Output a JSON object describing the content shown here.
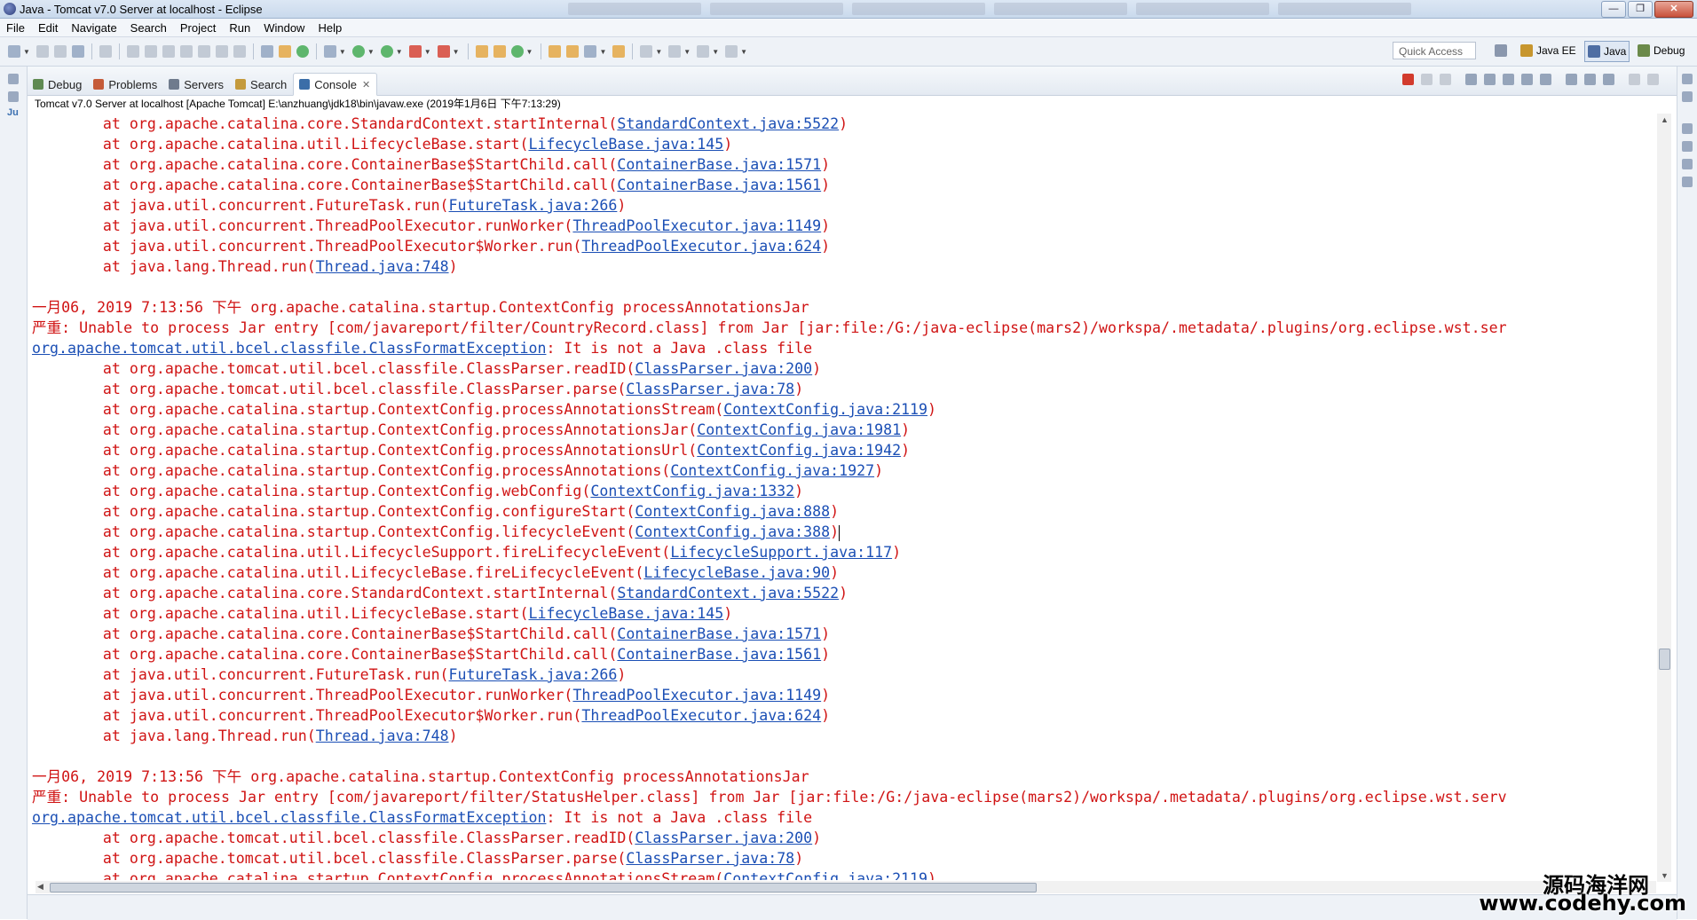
{
  "window": {
    "title": "Java - Tomcat v7.0 Server at localhost - Eclipse",
    "controls": {
      "minimize": "—",
      "maximize": "❐",
      "close": "✕"
    }
  },
  "menu": [
    "File",
    "Edit",
    "Navigate",
    "Search",
    "Project",
    "Run",
    "Window",
    "Help"
  ],
  "toolbar": {
    "quick_access": "Quick Access",
    "perspectives": [
      "Java EE",
      "Java",
      "Debug"
    ]
  },
  "views": {
    "tabs": [
      "Debug",
      "Problems",
      "Servers",
      "Search",
      "Console"
    ],
    "active": "Console",
    "close_glyph": "✕"
  },
  "console": {
    "description": "Tomcat v7.0 Server at localhost [Apache Tomcat] E:\\anzhuang\\jdk18\\bin\\javaw.exe (2019年1月6日 下午7:13:29)",
    "lines": [
      {
        "pre": "        at org.apache.catalina.core.StandardContext.startInternal(",
        "link": "StandardContext.java:5522",
        "post": ")"
      },
      {
        "pre": "        at org.apache.catalina.util.LifecycleBase.start(",
        "link": "LifecycleBase.java:145",
        "post": ")"
      },
      {
        "pre": "        at org.apache.catalina.core.ContainerBase$StartChild.call(",
        "link": "ContainerBase.java:1571",
        "post": ")"
      },
      {
        "pre": "        at org.apache.catalina.core.ContainerBase$StartChild.call(",
        "link": "ContainerBase.java:1561",
        "post": ")"
      },
      {
        "pre": "        at java.util.concurrent.FutureTask.run(",
        "link": "FutureTask.java:266",
        "post": ")"
      },
      {
        "pre": "        at java.util.concurrent.ThreadPoolExecutor.runWorker(",
        "link": "ThreadPoolExecutor.java:1149",
        "post": ")"
      },
      {
        "pre": "        at java.util.concurrent.ThreadPoolExecutor$Worker.run(",
        "link": "ThreadPoolExecutor.java:624",
        "post": ")"
      },
      {
        "pre": "        at java.lang.Thread.run(",
        "link": "Thread.java:748",
        "post": ")"
      },
      {
        "pre": ""
      },
      {
        "pre": "一月06, 2019 7:13:56 下午 org.apache.catalina.startup.ContextConfig processAnnotationsJar"
      },
      {
        "pre": "严重: Unable to process Jar entry [com/javareport/filter/CountryRecord.class] from Jar [jar:file:/G:/java-eclipse(mars2)/workspa/.metadata/.plugins/org.eclipse.wst.ser"
      },
      {
        "pre": "",
        "link": "org.apache.tomcat.util.bcel.classfile.ClassFormatException",
        "post": ": It is not a Java .class file"
      },
      {
        "pre": "        at org.apache.tomcat.util.bcel.classfile.ClassParser.readID(",
        "link": "ClassParser.java:200",
        "post": ")"
      },
      {
        "pre": "        at org.apache.tomcat.util.bcel.classfile.ClassParser.parse(",
        "link": "ClassParser.java:78",
        "post": ")"
      },
      {
        "pre": "        at org.apache.catalina.startup.ContextConfig.processAnnotationsStream(",
        "link": "ContextConfig.java:2119",
        "post": ")"
      },
      {
        "pre": "        at org.apache.catalina.startup.ContextConfig.processAnnotationsJar(",
        "link": "ContextConfig.java:1981",
        "post": ")"
      },
      {
        "pre": "        at org.apache.catalina.startup.ContextConfig.processAnnotationsUrl(",
        "link": "ContextConfig.java:1942",
        "post": ")"
      },
      {
        "pre": "        at org.apache.catalina.startup.ContextConfig.processAnnotations(",
        "link": "ContextConfig.java:1927",
        "post": ")"
      },
      {
        "pre": "        at org.apache.catalina.startup.ContextConfig.webConfig(",
        "link": "ContextConfig.java:1332",
        "post": ")"
      },
      {
        "pre": "        at org.apache.catalina.startup.ContextConfig.configureStart(",
        "link": "ContextConfig.java:888",
        "post": ")"
      },
      {
        "pre": "        at org.apache.catalina.startup.ContextConfig.lifecycleEvent(",
        "link": "ContextConfig.java:388",
        "post": ")",
        "caret": true
      },
      {
        "pre": "        at org.apache.catalina.util.LifecycleSupport.fireLifecycleEvent(",
        "link": "LifecycleSupport.java:117",
        "post": ")"
      },
      {
        "pre": "        at org.apache.catalina.util.LifecycleBase.fireLifecycleEvent(",
        "link": "LifecycleBase.java:90",
        "post": ")"
      },
      {
        "pre": "        at org.apache.catalina.core.StandardContext.startInternal(",
        "link": "StandardContext.java:5522",
        "post": ")"
      },
      {
        "pre": "        at org.apache.catalina.util.LifecycleBase.start(",
        "link": "LifecycleBase.java:145",
        "post": ")"
      },
      {
        "pre": "        at org.apache.catalina.core.ContainerBase$StartChild.call(",
        "link": "ContainerBase.java:1571",
        "post": ")"
      },
      {
        "pre": "        at org.apache.catalina.core.ContainerBase$StartChild.call(",
        "link": "ContainerBase.java:1561",
        "post": ")"
      },
      {
        "pre": "        at java.util.concurrent.FutureTask.run(",
        "link": "FutureTask.java:266",
        "post": ")"
      },
      {
        "pre": "        at java.util.concurrent.ThreadPoolExecutor.runWorker(",
        "link": "ThreadPoolExecutor.java:1149",
        "post": ")"
      },
      {
        "pre": "        at java.util.concurrent.ThreadPoolExecutor$Worker.run(",
        "link": "ThreadPoolExecutor.java:624",
        "post": ")"
      },
      {
        "pre": "        at java.lang.Thread.run(",
        "link": "Thread.java:748",
        "post": ")"
      },
      {
        "pre": ""
      },
      {
        "pre": "一月06, 2019 7:13:56 下午 org.apache.catalina.startup.ContextConfig processAnnotationsJar"
      },
      {
        "pre": "严重: Unable to process Jar entry [com/javareport/filter/StatusHelper.class] from Jar [jar:file:/G:/java-eclipse(mars2)/workspa/.metadata/.plugins/org.eclipse.wst.serv"
      },
      {
        "pre": "",
        "link": "org.apache.tomcat.util.bcel.classfile.ClassFormatException",
        "post": ": It is not a Java .class file"
      },
      {
        "pre": "        at org.apache.tomcat.util.bcel.classfile.ClassParser.readID(",
        "link": "ClassParser.java:200",
        "post": ")"
      },
      {
        "pre": "        at org.apache.tomcat.util.bcel.classfile.ClassParser.parse(",
        "link": "ClassParser.java:78",
        "post": ")"
      },
      {
        "pre": "        at org.apache.catalina.startup.ContextConfig.processAnnotationsStream(",
        "link": "ContextConfig.java:2119",
        "post": ")"
      }
    ]
  },
  "watermark": {
    "line1": "源码海洋网",
    "line2": "www.codehy.com"
  },
  "colors": {
    "error_text": "#d01414",
    "link": "#1b4fb5"
  }
}
